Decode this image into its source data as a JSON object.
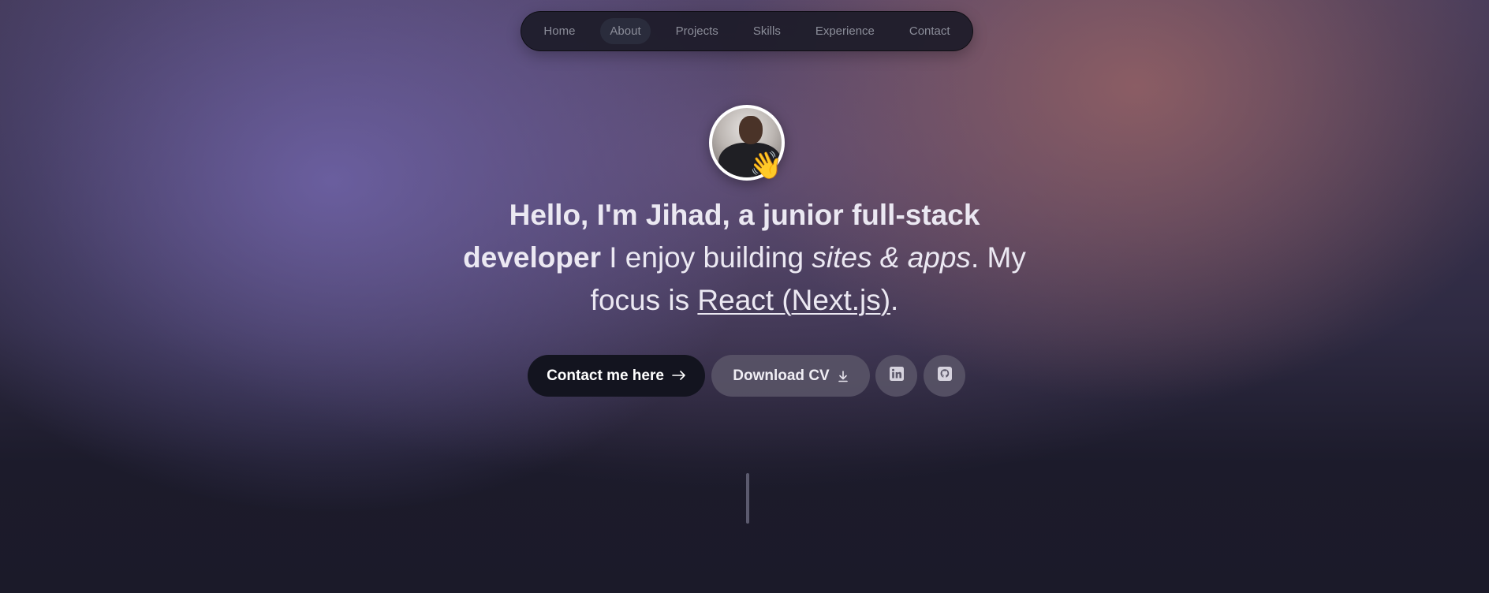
{
  "nav": {
    "items": [
      {
        "label": "Home",
        "active": false
      },
      {
        "label": "About",
        "active": true
      },
      {
        "label": "Projects",
        "active": false
      },
      {
        "label": "Skills",
        "active": false
      },
      {
        "label": "Experience",
        "active": false
      },
      {
        "label": "Contact",
        "active": false
      }
    ]
  },
  "hero": {
    "avatar_icon": "profile-photo",
    "wave_emoji": "👋",
    "headline": {
      "bold_part": "Hello, I'm Jihad, a junior full-stack developer",
      "plain_1": " I enjoy building ",
      "italic_part": "sites & apps",
      "plain_2": ". My focus is ",
      "underlined_part": "React (Next.js)",
      "plain_3": "."
    }
  },
  "actions": {
    "contact_label": "Contact me here",
    "contact_icon": "arrow-right-icon",
    "cv_label": "Download CV",
    "cv_icon": "download-icon",
    "linkedin_icon": "linkedin-icon",
    "github_icon": "github-icon"
  },
  "colors": {
    "accent_dark": "#13141f",
    "text_light": "#ebe8f2",
    "nav_bg": "#1c1b28"
  }
}
